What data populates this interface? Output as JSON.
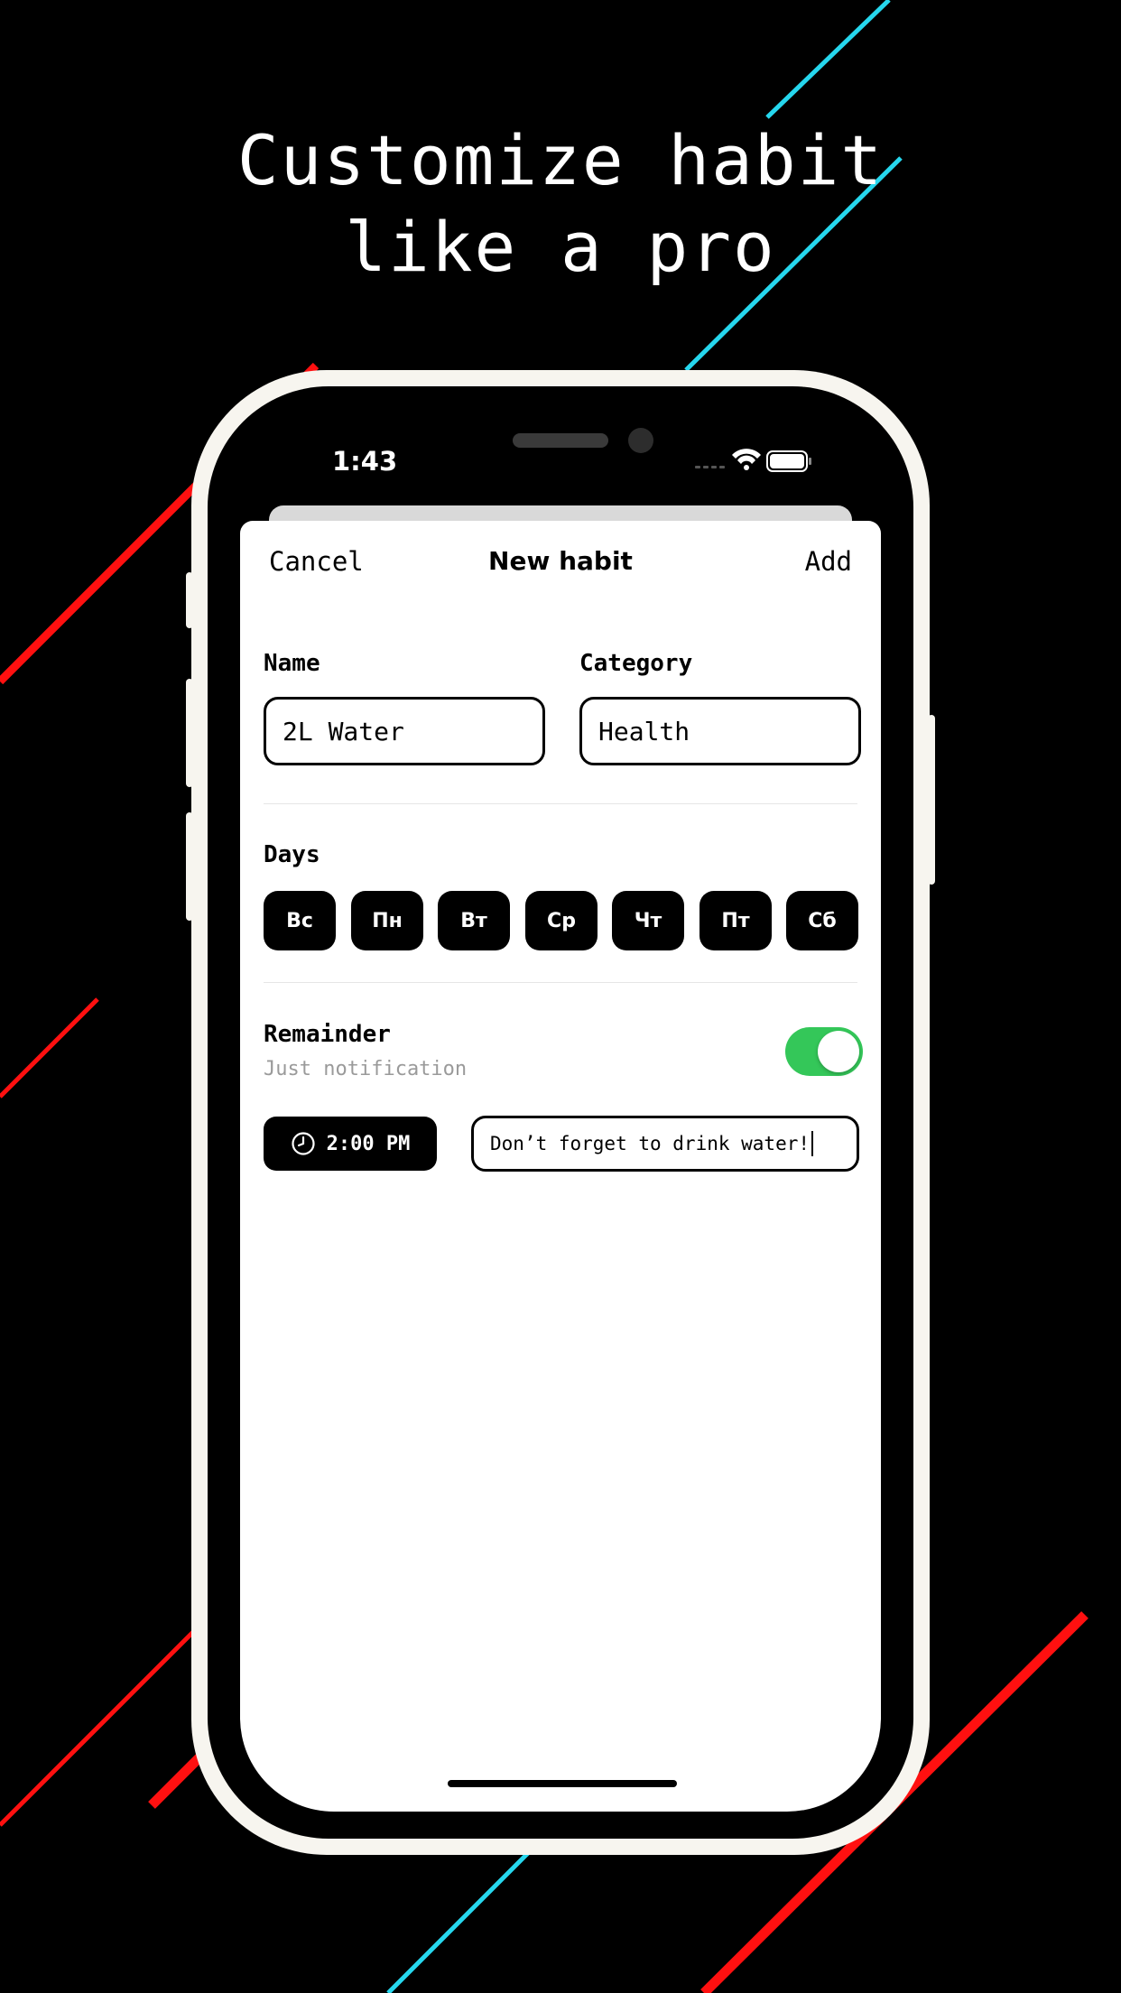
{
  "headline": {
    "line1": "Customize habit",
    "line2": "like a pro"
  },
  "colors": {
    "background": "#000000",
    "line_red": "#ff1010",
    "line_cyan": "#26d7ee",
    "toggle_on": "#34c759",
    "phone_frame": "#f7f5ef"
  },
  "status_bar": {
    "time": "1:43",
    "icons": [
      "signal-icon",
      "wifi-icon",
      "battery-icon"
    ]
  },
  "nav": {
    "cancel_label": "Cancel",
    "title": "New habit",
    "add_label": "Add"
  },
  "form": {
    "name_label": "Name",
    "name_value": "2L Water",
    "category_label": "Category",
    "category_value": "Health",
    "days_label": "Days",
    "days": [
      "Вс",
      "Пн",
      "Вт",
      "Ср",
      "Чт",
      "Пт",
      "Сб"
    ],
    "reminder_label": "Remainder",
    "reminder_sub": "Just notification",
    "reminder_enabled": true,
    "time_value": "2:00 PM",
    "message_value": "Don’t forget to drink water!"
  }
}
